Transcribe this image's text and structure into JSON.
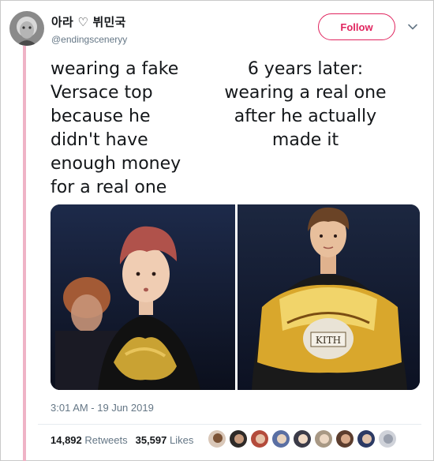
{
  "tweet": {
    "display_name": "아라 ♡ 뷔민국",
    "handle": "@endingsceneryy",
    "follow_label": "Follow",
    "timestamp": "3:01 AM - 19 Jun 2019",
    "retweets_count": "14,892",
    "retweets_label": "Retweets",
    "likes_count": "35,597",
    "likes_label": "Likes",
    "caption_left": [
      "wearing a fake",
      "Versace top",
      "because he",
      "didn't have",
      "enough money",
      "for a real one"
    ],
    "caption_right": [
      "6 years later:",
      "wearing a real one",
      "after he actually",
      "made it"
    ],
    "shirt_text": "KITH"
  },
  "colors": {
    "accent": "#e0245e",
    "thread_line": "#efb3c6",
    "muted": "#657786",
    "text": "#14171a"
  },
  "icons": {
    "chevron": "chevron-down-icon"
  },
  "likers": [
    "liker-1",
    "liker-2",
    "liker-3",
    "liker-4",
    "liker-5",
    "liker-6",
    "liker-7",
    "liker-8",
    "liker-9",
    "liker-10"
  ]
}
